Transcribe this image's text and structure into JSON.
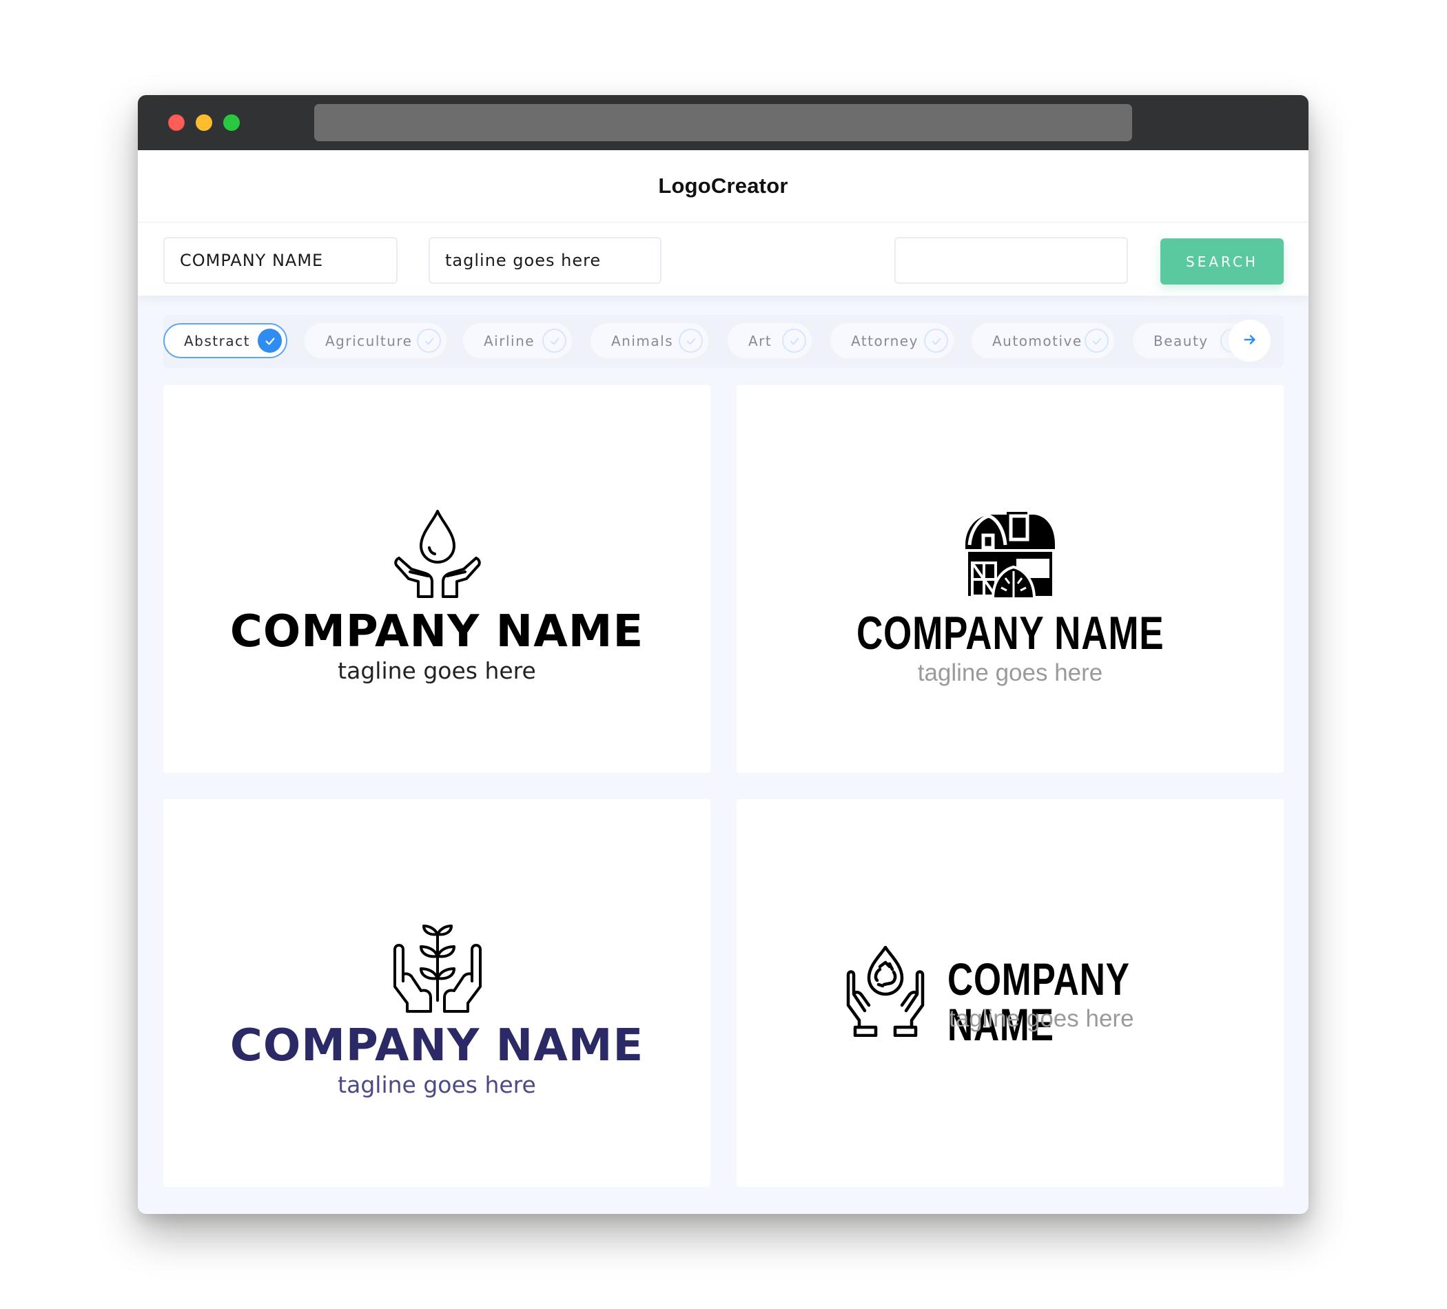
{
  "window": {
    "title_bar": {
      "buttons": [
        "close",
        "minimize",
        "maximize"
      ],
      "colors": {
        "close": "#fd5f57",
        "minimize": "#febc2e",
        "maximize": "#2ac840"
      }
    }
  },
  "header": {
    "brand": "LogoCreator"
  },
  "toolbar": {
    "company_name_value": "COMPANY NAME",
    "tagline_value": "tagline goes here",
    "search_value": "",
    "search_label": "SEARCH",
    "search_color": "#5bc9a0"
  },
  "categories": {
    "accent": "#2f8cf0",
    "items": [
      {
        "label": "Abstract",
        "selected": true
      },
      {
        "label": "Agriculture",
        "selected": false
      },
      {
        "label": "Airline",
        "selected": false
      },
      {
        "label": "Animals",
        "selected": false
      },
      {
        "label": "Art",
        "selected": false
      },
      {
        "label": "Attorney",
        "selected": false
      },
      {
        "label": "Automotive",
        "selected": false
      },
      {
        "label": "Beauty",
        "selected": false
      }
    ],
    "next_icon": "arrow-right-icon"
  },
  "logos": [
    {
      "icon": "water-drop-hands-icon",
      "company": "COMPANY NAME",
      "tagline": "tagline goes here",
      "layout": "stacked",
      "name_color": "#000000",
      "tagline_color": "#222222"
    },
    {
      "icon": "barn-haystack-icon",
      "company": "COMPANY NAME",
      "tagline": "tagline goes here",
      "layout": "stacked",
      "name_color": "#000000",
      "tagline_color": "#9a9a9a"
    },
    {
      "icon": "plant-hands-icon",
      "company": "COMPANY NAME",
      "tagline": "tagline goes here",
      "layout": "stacked",
      "name_color": "#2b2966",
      "tagline_color": "#4b4a86"
    },
    {
      "icon": "recycle-drop-hands-icon",
      "company": "COMPANY NAME",
      "tagline": "tagline goes here",
      "layout": "inline",
      "name_color": "#000000",
      "tagline_color": "#9a9a9a"
    }
  ]
}
